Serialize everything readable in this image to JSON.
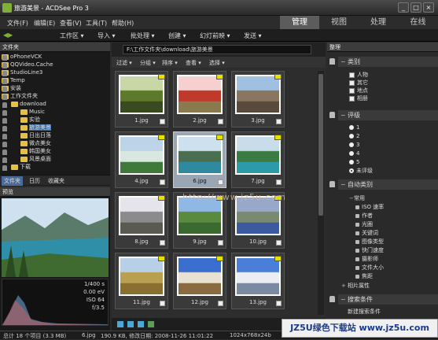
{
  "window": {
    "title": "旅游美景 - ACDSee Pro 3",
    "min": "_",
    "max": "□",
    "close": "×"
  },
  "menu": [
    "文件(F)",
    "编辑(E)",
    "查看(V)",
    "工具(T)",
    "帮助(H)"
  ],
  "mode_tabs": {
    "items": [
      "管理",
      "视图",
      "处理",
      "在线"
    ],
    "active": "管理"
  },
  "toolbar": [
    "工作区 ▾",
    "导入 ▾",
    "批处理 ▾",
    "创建 ▾",
    "幻灯前映 ▾",
    "发送 ▾"
  ],
  "folders": {
    "title": "文件夹",
    "items": [
      {
        "label": "oPhoneVCK"
      },
      {
        "label": "QQVideo.Cache"
      },
      {
        "label": "StudioLine3"
      },
      {
        "label": "Temp"
      },
      {
        "label": "安装"
      },
      {
        "label": "工作文件夹"
      },
      {
        "label": "download"
      },
      {
        "label": "Music"
      },
      {
        "label": "实验"
      },
      {
        "label": "旅游美景",
        "selected": true
      },
      {
        "label": "日出日落"
      },
      {
        "label": "微点美女"
      },
      {
        "label": "韩国美女"
      },
      {
        "label": "风景桌面"
      },
      {
        "label": "下载"
      }
    ]
  },
  "left_tabs": {
    "items": [
      "文件夹",
      "日历",
      "收藏夹"
    ],
    "active": "文件夹"
  },
  "preview": {
    "title": "预览",
    "exif": [
      "1/400 s",
      "0.00 eV",
      "ISO 64",
      "f/3.5"
    ]
  },
  "browser": {
    "path": "F:\\工作文件夹\\download\\旅游美景",
    "filters": [
      "过滤 ▾",
      "分组 ▾",
      "排序 ▾",
      "查看 ▾",
      "选择 ▾"
    ],
    "watermark": "http://www.jz5u.com",
    "thumbs": [
      {
        "name": "1.jpg",
        "colors": [
          "#c8d7a5",
          "#5d7a2c",
          "#3a4a20"
        ]
      },
      {
        "name": "2.jpg",
        "colors": [
          "#f5d0cf",
          "#c0392b",
          "#8a7a50"
        ]
      },
      {
        "name": "3.jpg",
        "colors": [
          "#9fc0e0",
          "#8a7560",
          "#5a4a3c"
        ]
      },
      {
        "name": "4.jpg",
        "colors": [
          "#bcd3e8",
          "#d8e8e0",
          "#3f7a3a"
        ]
      },
      {
        "name": "6.jpg",
        "colors": [
          "#cde0ee",
          "#4a6f50",
          "#2f8aa0"
        ],
        "selected": true
      },
      {
        "name": "7.jpg",
        "colors": [
          "#c9dcea",
          "#3b7a43",
          "#2c9aa8"
        ]
      },
      {
        "name": "8.jpg",
        "colors": [
          "#e4e4ea",
          "#8b8b8b",
          "#5a5a50"
        ]
      },
      {
        "name": "9.jpg",
        "colors": [
          "#8fb8e5",
          "#5a8a40",
          "#3a6a30"
        ]
      },
      {
        "name": "10.jpg",
        "colors": [
          "#98a8c8",
          "#7a8a70",
          "#3b5aa0"
        ]
      },
      {
        "name": "11.jpg",
        "colors": [
          "#b7d0e8",
          "#b8a050",
          "#8a7030"
        ]
      },
      {
        "name": "12.jpg",
        "colors": [
          "#3a6fd0",
          "#e8e0d0",
          "#8a6a40"
        ]
      },
      {
        "name": "13.jpg",
        "colors": [
          "#4a7fd8",
          "#eaeef2",
          "#7a8aa0"
        ]
      }
    ]
  },
  "organize": {
    "title": "整理",
    "categories_title": "类别",
    "categories": [
      "人物",
      "其它",
      "地点",
      "相册"
    ],
    "ratings_title": "评级",
    "ratings": [
      "1",
      "2",
      "3",
      "4",
      "5",
      "未评级"
    ],
    "auto_title": "自动类别",
    "common_label": "常用",
    "auto_items": [
      "ISO 速率",
      "作者",
      "光圈",
      "关键词",
      "图像类型",
      "快门速度",
      "摄影师",
      "文件大小",
      "焦距"
    ],
    "photo_props": "相片属性",
    "search_title": "搜索条件",
    "new_search": "新建搜索条件"
  },
  "status": {
    "total": "总计 18 个项目 (3.3 MB)",
    "file": "6.jpg",
    "info": "190.9 KB, 修改日期: 2008-11-26 11:01:22",
    "dims": "1024x768x24b"
  },
  "site_banner": "JZ5U绿色下载站 www.jz5u.com"
}
